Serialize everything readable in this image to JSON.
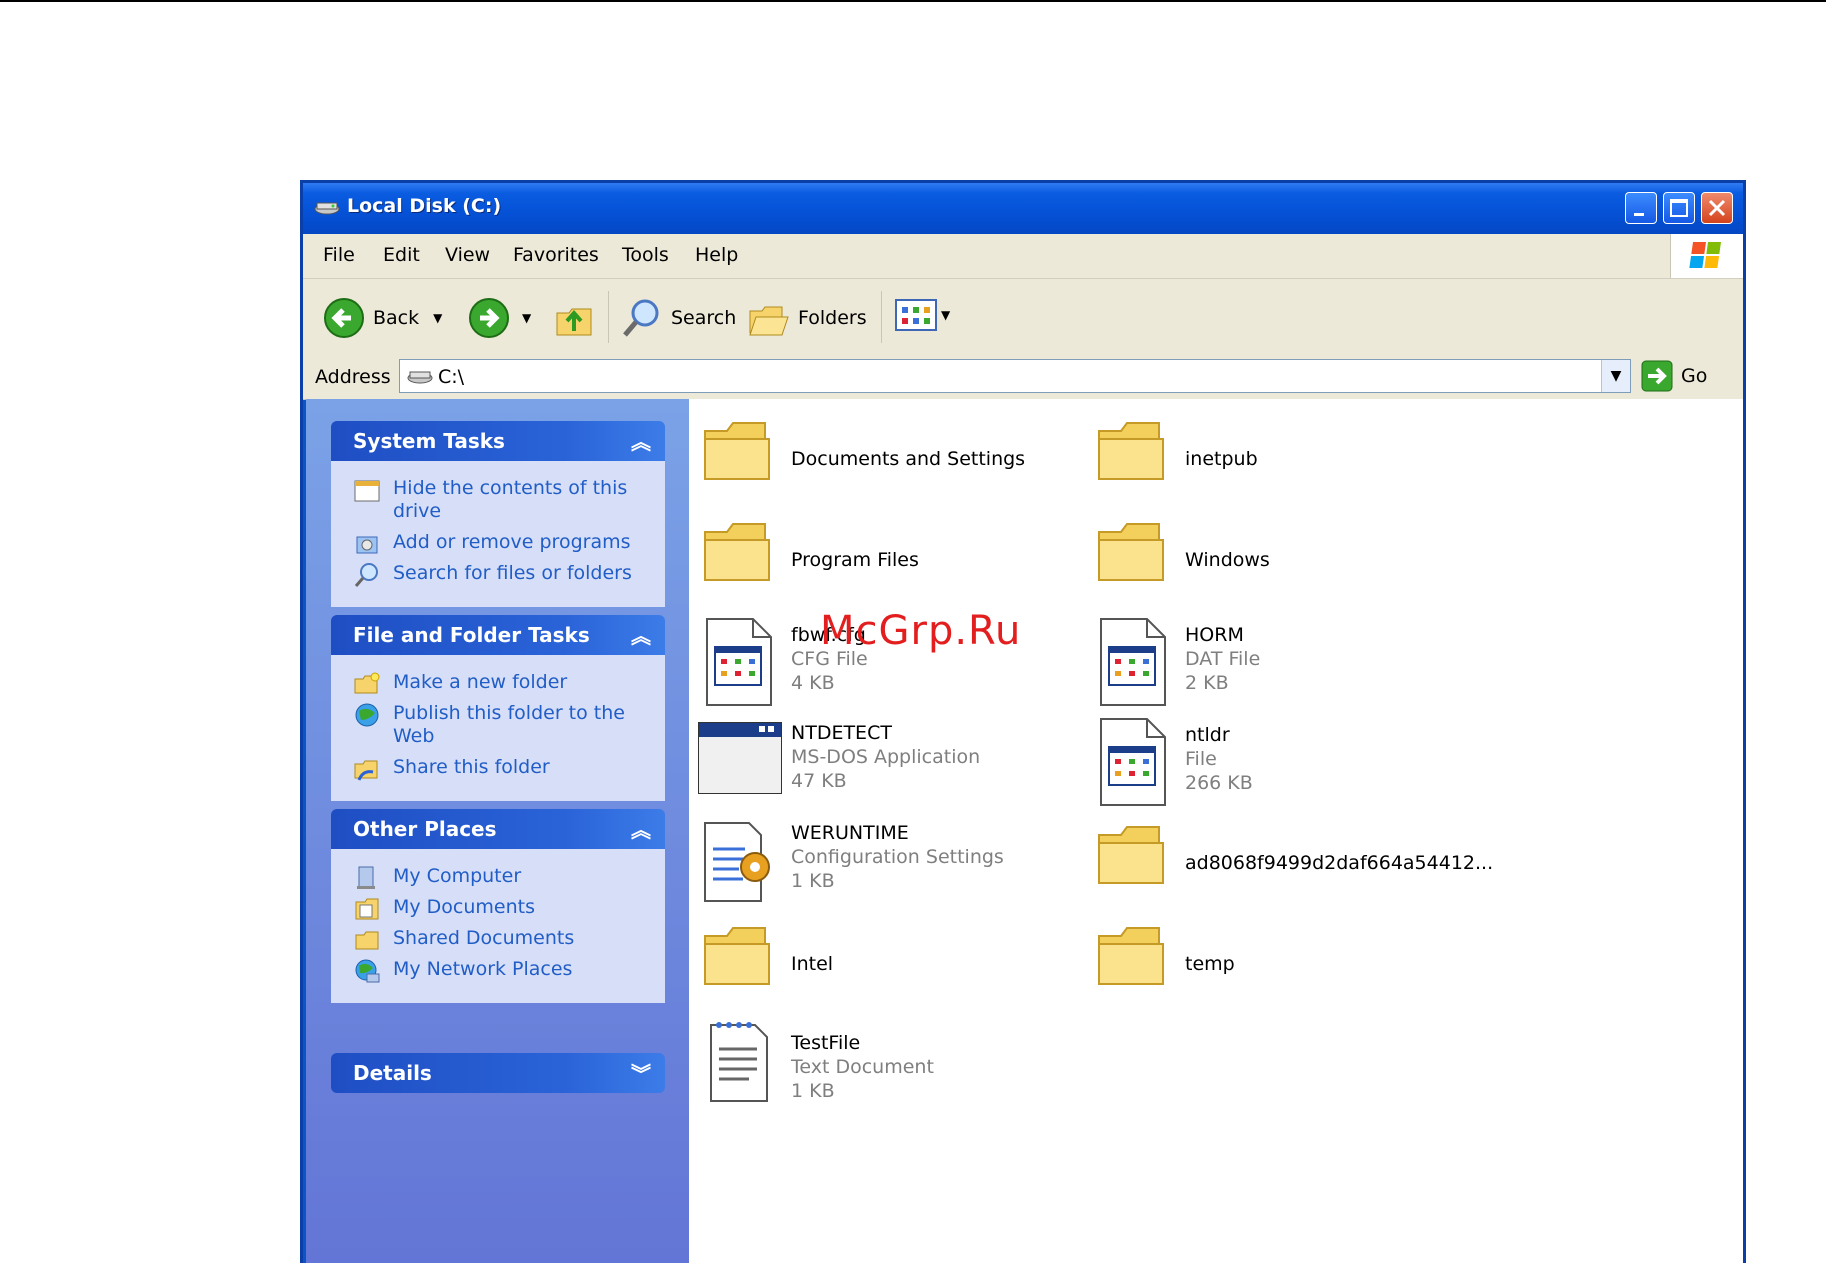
{
  "window": {
    "title": "Local Disk (C:)"
  },
  "menu": [
    "File",
    "Edit",
    "View",
    "Favorites",
    "Tools",
    "Help"
  ],
  "toolbar": {
    "back_label": "Back",
    "search_label": "Search",
    "folders_label": "Folders"
  },
  "address": {
    "label": "Address",
    "value": "C:\\",
    "go_label": "Go"
  },
  "panels": {
    "system_tasks": {
      "title": "System Tasks",
      "links": [
        "Hide the contents of this drive",
        "Add or remove programs",
        "Search for files or folders"
      ]
    },
    "file_folder_tasks": {
      "title": "File and Folder Tasks",
      "links": [
        "Make a new folder",
        "Publish this folder to the Web",
        "Share this folder"
      ]
    },
    "other_places": {
      "title": "Other Places",
      "links": [
        "My Computer",
        "My Documents",
        "Shared Documents",
        "My Network Places"
      ]
    },
    "details": {
      "title": "Details"
    }
  },
  "files": [
    {
      "name": "Documents and Settings",
      "icon": "folder-icon"
    },
    {
      "name": "inetpub",
      "icon": "folder-icon"
    },
    {
      "name": "Program Files",
      "icon": "folder-icon"
    },
    {
      "name": "Windows",
      "icon": "folder-icon"
    },
    {
      "name": "fbwf.cfg",
      "type": "CFG File",
      "size": "4 KB",
      "icon": "file-icon"
    },
    {
      "name": "HORM",
      "type": "DAT File",
      "size": "2 KB",
      "icon": "file-icon"
    },
    {
      "name": "NTDETECT",
      "type": "MS-DOS Application",
      "size": "47 KB",
      "icon": "application-icon"
    },
    {
      "name": "ntldr",
      "type": "File",
      "size": "266 KB",
      "icon": "file-icon"
    },
    {
      "name": "WERUNTIME",
      "type": "Configuration Settings",
      "size": "1 KB",
      "icon": "config-file-icon"
    },
    {
      "name": "ad8068f9499d2daf664a54412...",
      "icon": "folder-icon"
    },
    {
      "name": "Intel",
      "icon": "folder-icon"
    },
    {
      "name": "temp",
      "icon": "folder-icon"
    },
    {
      "name": "TestFile",
      "type": "Text Document",
      "size": "1 KB",
      "icon": "text-document-icon"
    }
  ],
  "watermark": "McGrp.Ru",
  "colors": {
    "titlebar": "#0551d6",
    "task_pane": "#6f8fe0",
    "panel_body": "#d6dff7",
    "link": "#215dc6",
    "chrome": "#ece9d8",
    "watermark": "#e31e1e"
  }
}
